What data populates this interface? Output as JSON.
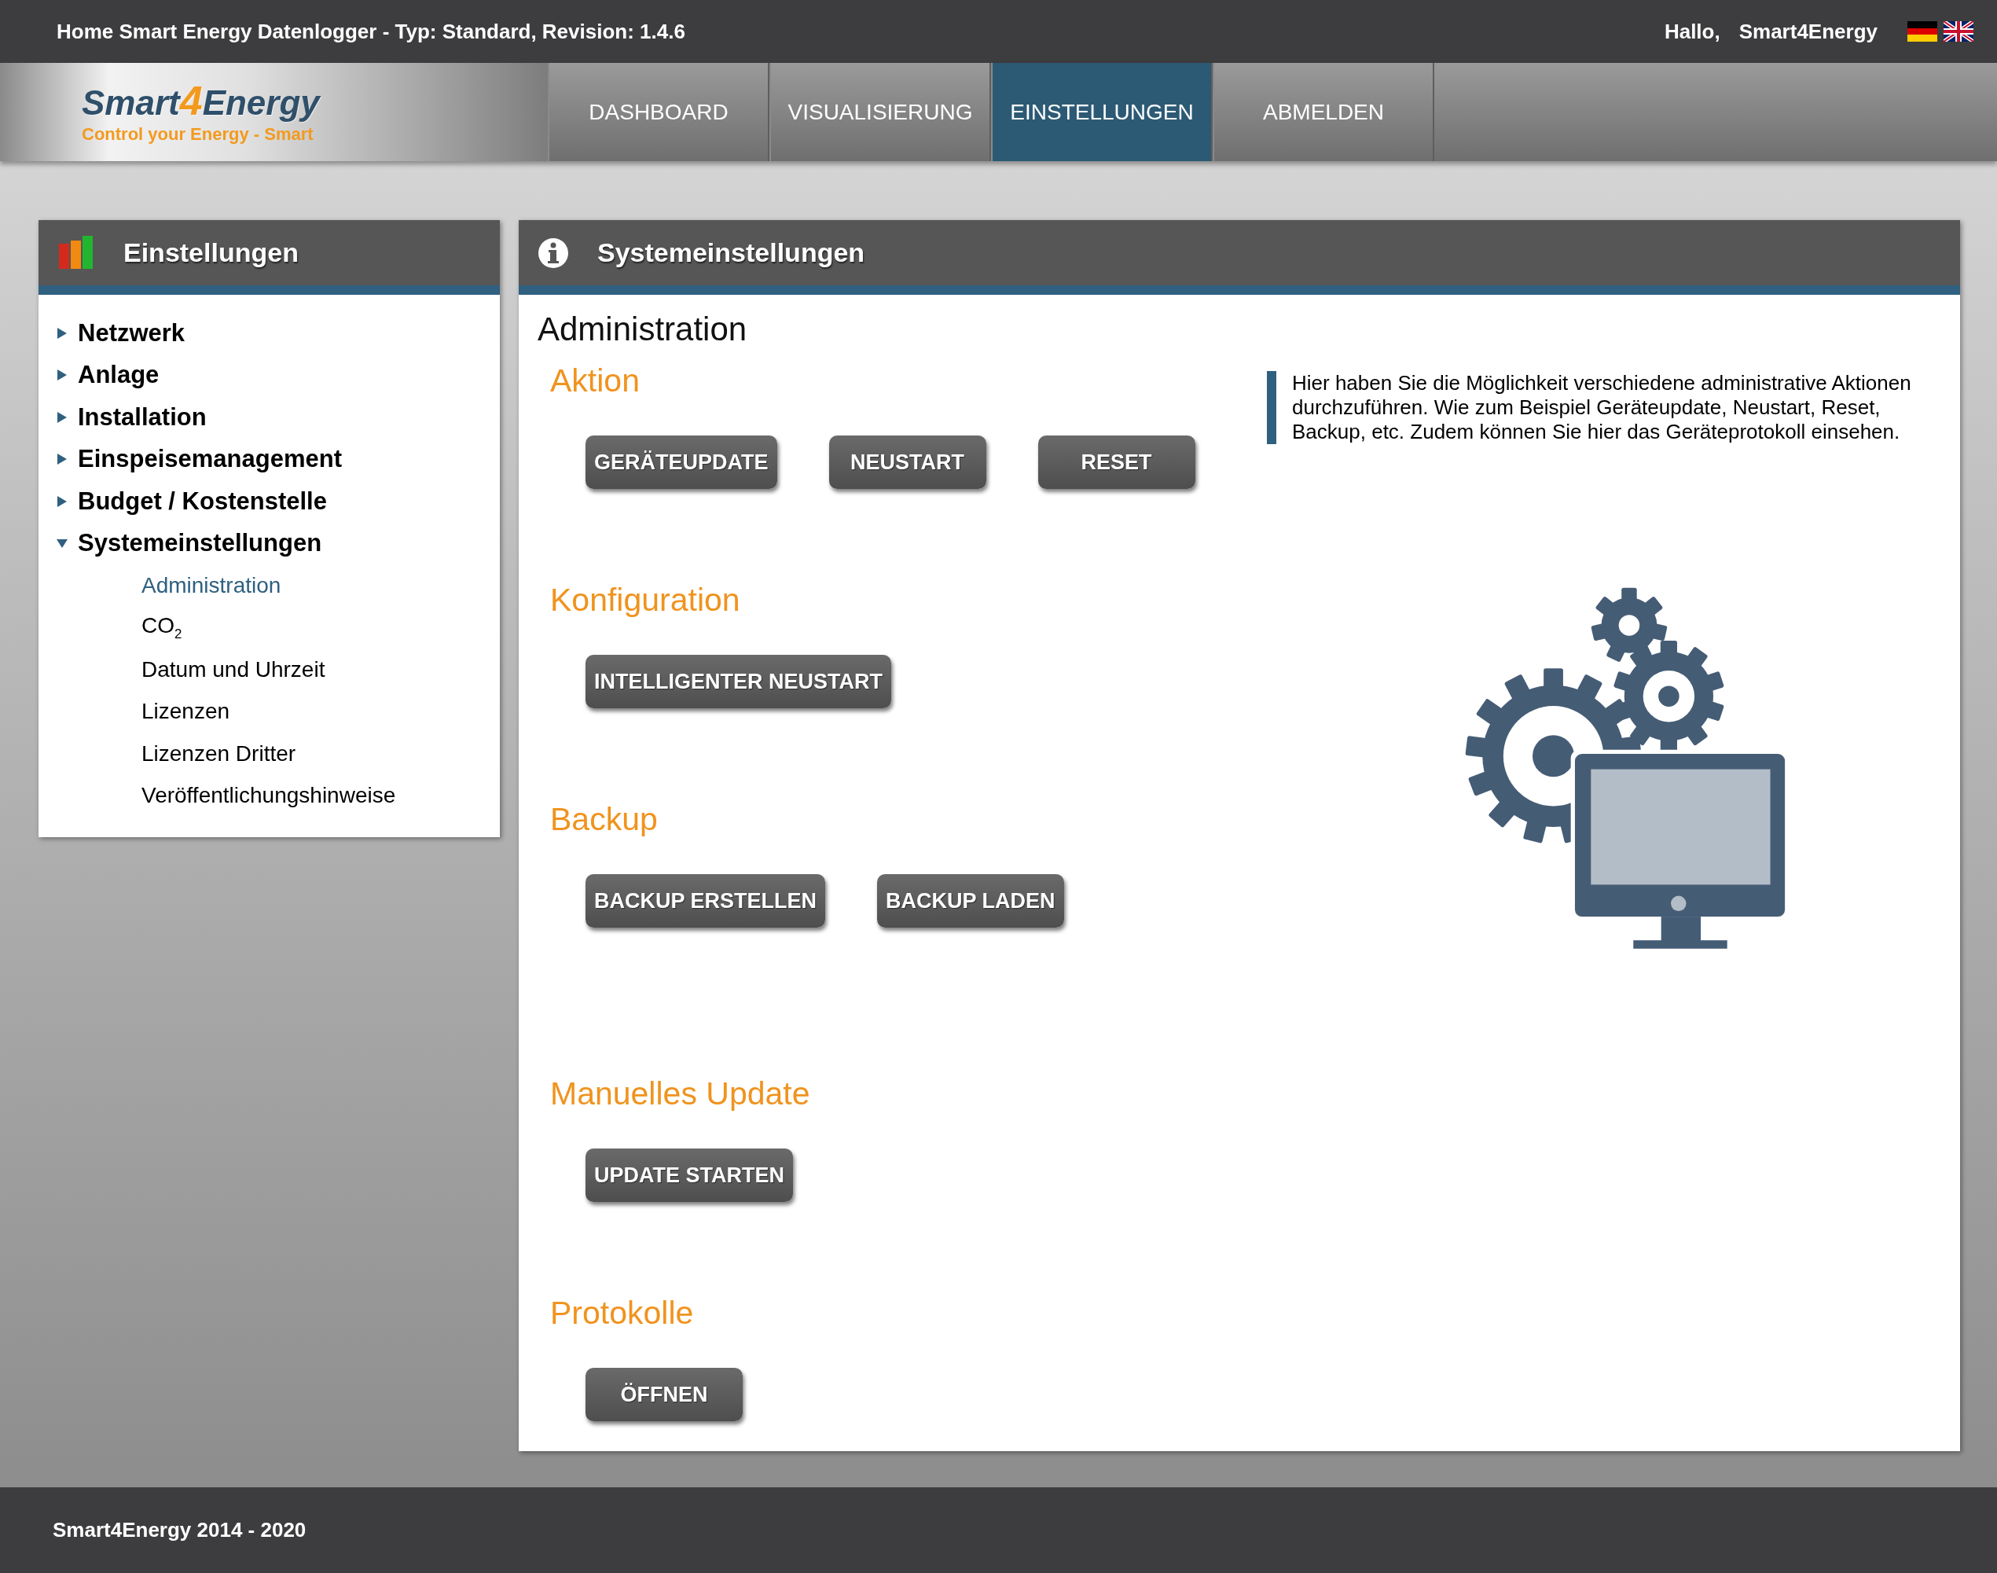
{
  "top_bar": {
    "title": "Home Smart Energy Datenlogger - Typ: Standard, Revision: 1.4.6",
    "greeting": "Hallo,",
    "user": "Smart4Energy"
  },
  "logo": {
    "wordmark_start": "Smart",
    "wordmark_digit": "4",
    "wordmark_end": "Energy",
    "tagline": "Control your Energy - Smart"
  },
  "nav_tabs": [
    {
      "label": "DASHBOARD",
      "selected": false
    },
    {
      "label": "VISUALISIERUNG",
      "selected": false
    },
    {
      "label": "EINSTELLUNGEN",
      "selected": true
    },
    {
      "label": "ABMELDEN",
      "selected": false
    }
  ],
  "sidebar": {
    "title": "Einstellungen",
    "items": [
      {
        "label": "Netzwerk",
        "expanded": false
      },
      {
        "label": "Anlage",
        "expanded": false
      },
      {
        "label": "Installation",
        "expanded": false
      },
      {
        "label": "Einspeisemanagement",
        "expanded": false
      },
      {
        "label": "Budget / Kostenstelle",
        "expanded": false
      },
      {
        "label": "Systemeinstellungen",
        "expanded": true,
        "children": [
          {
            "label": "Administration",
            "selected": true
          },
          {
            "label": "CO$_{2}$",
            "selected": false
          },
          {
            "label": "Datum und Uhrzeit",
            "selected": false
          },
          {
            "label": "Lizenzen",
            "selected": false
          },
          {
            "label": "Lizenzen Dritter",
            "selected": false
          },
          {
            "label": "Veröffentlichungshinweise",
            "selected": false
          }
        ]
      }
    ]
  },
  "panel": {
    "title": "Systemeinstellungen",
    "heading": "Administration",
    "description": "Hier haben Sie die Möglichkeit verschiedene administrative Aktionen durchzuführen. Wie zum Beispiel Geräteupdate, Neustart, Reset, Backup, etc. Zudem können Sie hier das Geräteprotokoll einsehen.",
    "sections": [
      {
        "title": "Aktion",
        "buttons": [
          "GERÄTEUPDATE",
          "NEUSTART",
          "RESET"
        ]
      },
      {
        "title": "Konfiguration",
        "buttons": [
          "INTELLIGENTER NEUSTART"
        ]
      },
      {
        "title": "Backup",
        "buttons": [
          "BACKUP ERSTELLEN",
          "BACKUP LADEN"
        ]
      },
      {
        "title": "Manuelles Update",
        "buttons": [
          "UPDATE STARTEN"
        ]
      },
      {
        "title": "Protokolle",
        "buttons": [
          "ÖFFNEN"
        ]
      }
    ]
  },
  "footer": {
    "text": "Smart4Energy 2014 - 2020"
  }
}
